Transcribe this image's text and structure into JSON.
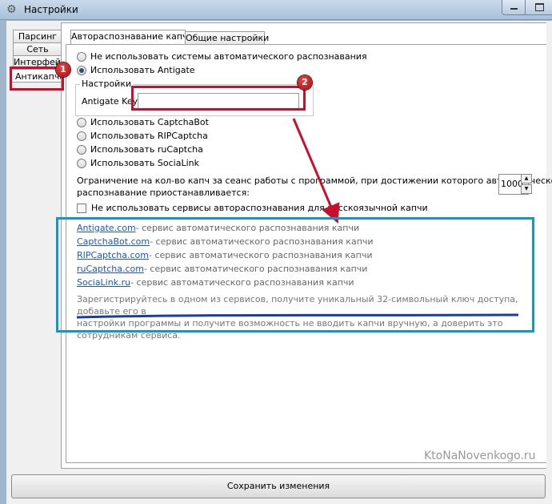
{
  "window": {
    "title": "Настройки"
  },
  "left_tabs": [
    "Парсинг",
    "Сеть",
    "Интерфейс",
    "Антикапча"
  ],
  "top_tabs": [
    "Автораспознавание капчи",
    "Общие настройки"
  ],
  "options": {
    "no_auto": "Не использовать системы автоматического распознавания",
    "antigate": "Использовать Antigate",
    "captchabot": "Использовать CaptchaBot",
    "ripcaptcha": "Использовать RIPCaptcha",
    "rucaptcha": "Использовать ruCaptcha",
    "socialink": "Использовать SociaLink"
  },
  "settings_group": {
    "label": "Настройки",
    "key_label": "Antigate Key",
    "key_value": ""
  },
  "limit": {
    "line1": "Ограничение на кол-во капч за сеанс работы с программой, при достижении которого автоматическое",
    "line2": "распознавание приостанавливается:",
    "value": "1000"
  },
  "russian_checkbox": "Не использовать сервисы автораспознавания для русскоязычной капчи",
  "services": [
    {
      "name": "Antigate.com",
      "desc": " - сервис автоматического распознавания капчи"
    },
    {
      "name": "CaptchaBot.com",
      "desc": " - сервис автоматического распознавания капчи"
    },
    {
      "name": "RIPCaptcha.com",
      "desc": " - сервис автоматического распознавания капчи"
    },
    {
      "name": "ruCaptcha.com",
      "desc": " - сервис автоматического распознавания капчи"
    },
    {
      "name": "SociaLink.ru",
      "desc": " - сервис автоматического распознавания капчи"
    }
  ],
  "notice": {
    "line1": "Зарегистрируйтесь в одном из сервисов, получите уникальный 32-символьный ключ доступа, добавьте его в",
    "line2": "настройки программы и получите возможность не вводить капчи вручную, а доверить это сотрудникам сервиса."
  },
  "badges": [
    "1",
    "2"
  ],
  "save_button": "Сохранить изменения",
  "watermark": "KtoNaNovenkogo.ru",
  "colors": {
    "annotation_red": "#c8102e",
    "annotation_blue": "#1597c0",
    "link": "#1c55c7"
  }
}
